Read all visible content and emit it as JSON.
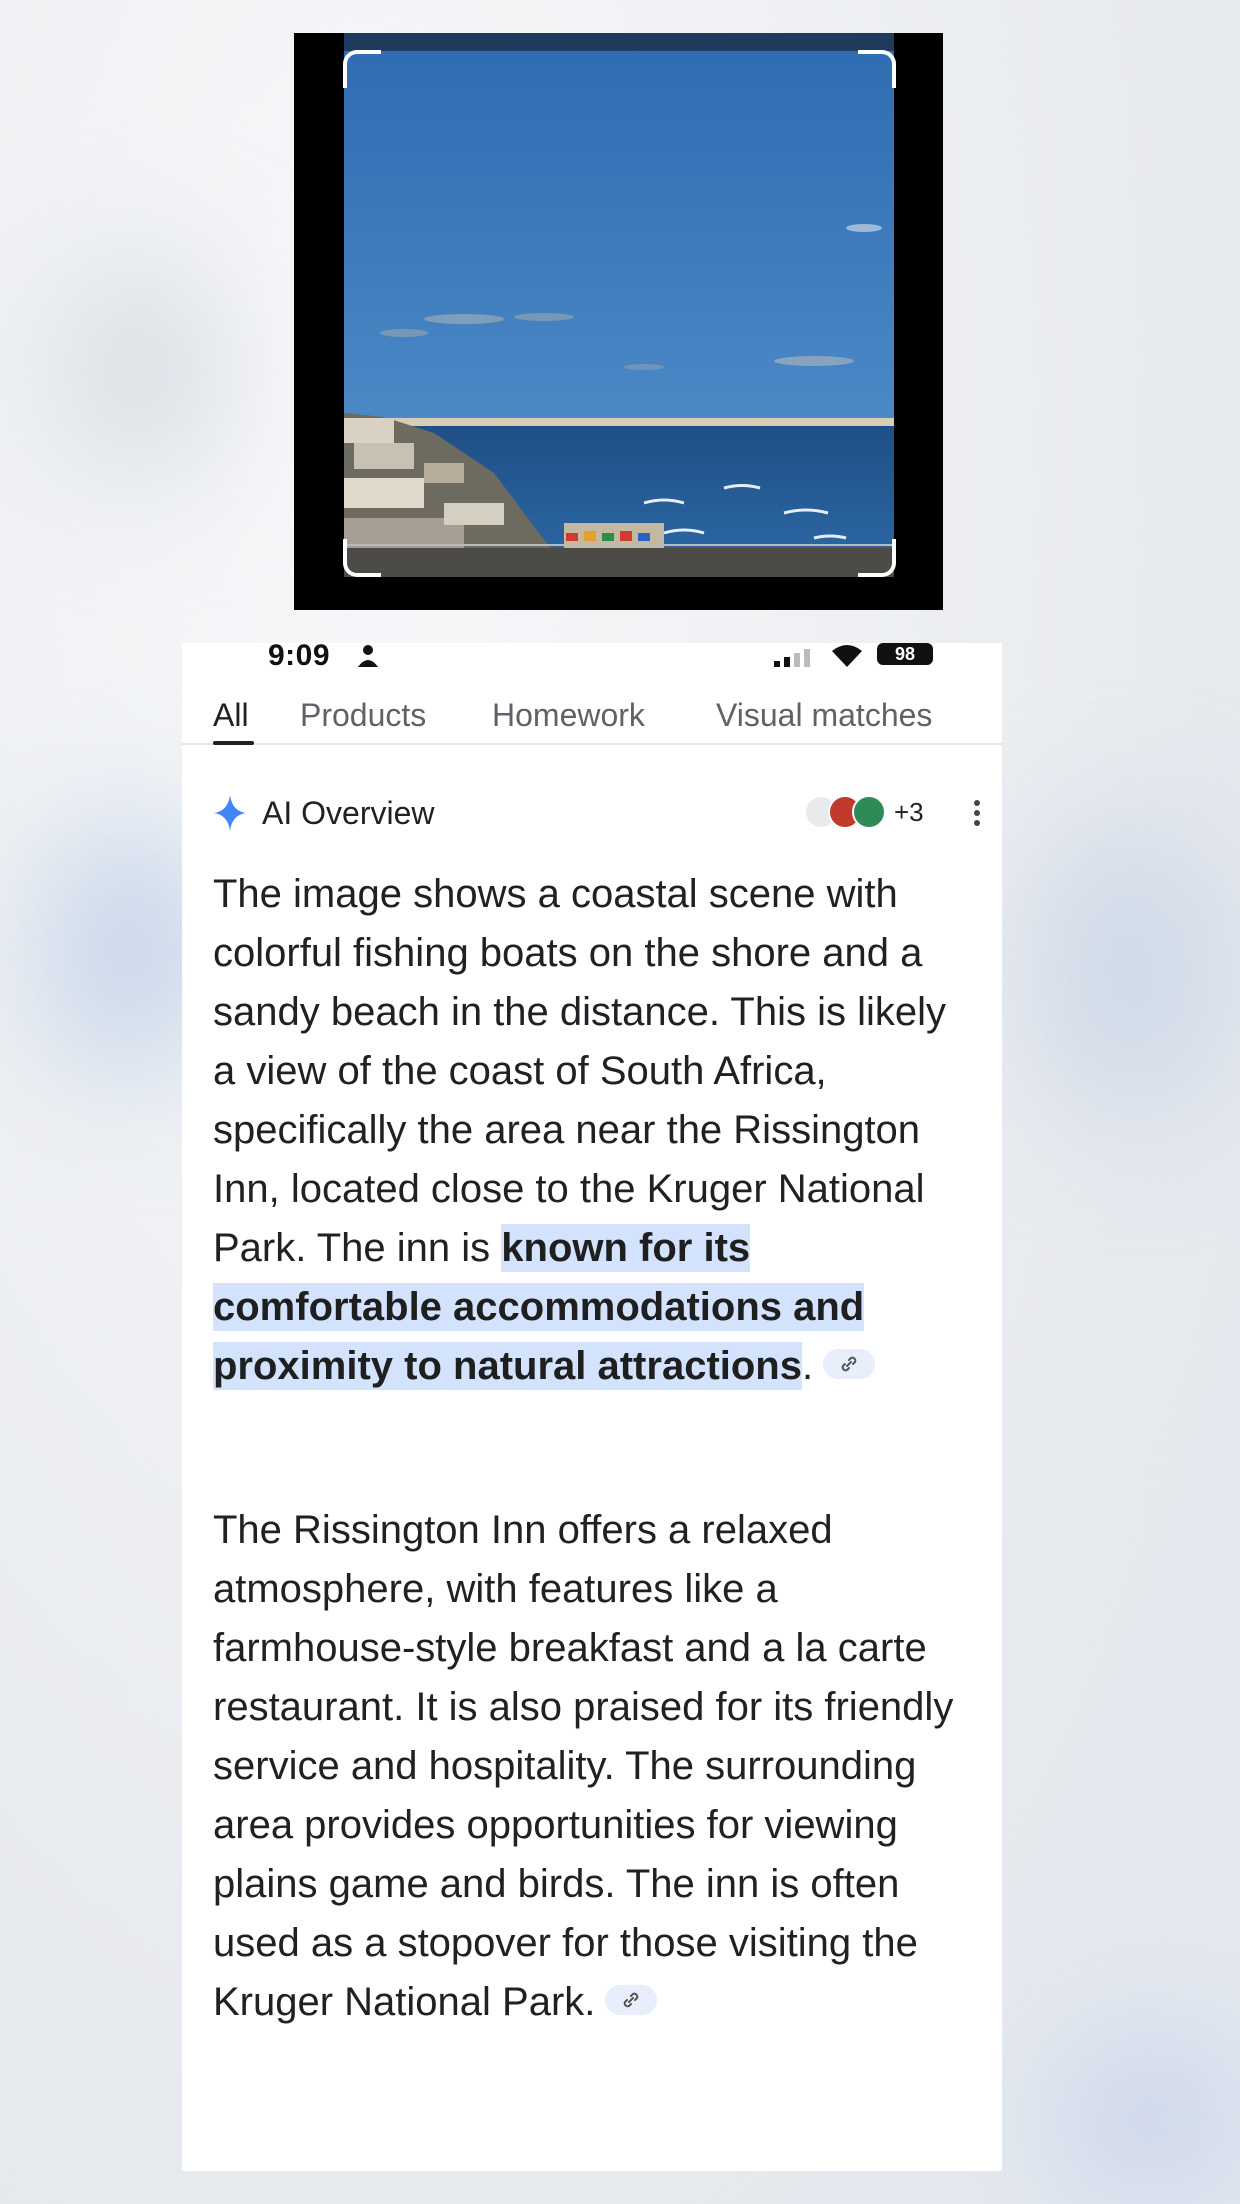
{
  "status_bar": {
    "time": "9:09",
    "battery": "98"
  },
  "tabs": [
    {
      "label": "All",
      "active": true
    },
    {
      "label": "Products",
      "active": false
    },
    {
      "label": "Homework",
      "active": false
    },
    {
      "label": "Visual matches",
      "active": false
    }
  ],
  "ai_overview": {
    "title": "AI Overview",
    "sources_more": "+3",
    "paragraph1": {
      "before": "The image shows a coastal scene with colorful fishing boats on the shore and a sandy beach in the distance. This is likely a view of the coast of South Africa, specifically the area near the Rissington Inn, located close to the Kruger National Park. The inn is ",
      "highlight": "known for its comfortable accommodations and proximity to natural attractions",
      "after": "."
    },
    "paragraph2": "The Rissington Inn offers a relaxed atmosphere, with features like a farmhouse-style breakfast and a la carte restaurant. It is also praised for its friendly service and hospitality. The surrounding area provides opportunities for viewing plains game and birds. The inn is often used as a stopover for those visiting the Kruger National Park."
  },
  "colors": {
    "accent": "#4285f4",
    "highlight": "#d3e3fd",
    "text": "#202124",
    "muted": "#5f6368"
  },
  "icons": [
    "person-icon",
    "signal-icon",
    "wifi-icon",
    "sparkle-icon",
    "more-vert-icon",
    "link-icon"
  ]
}
